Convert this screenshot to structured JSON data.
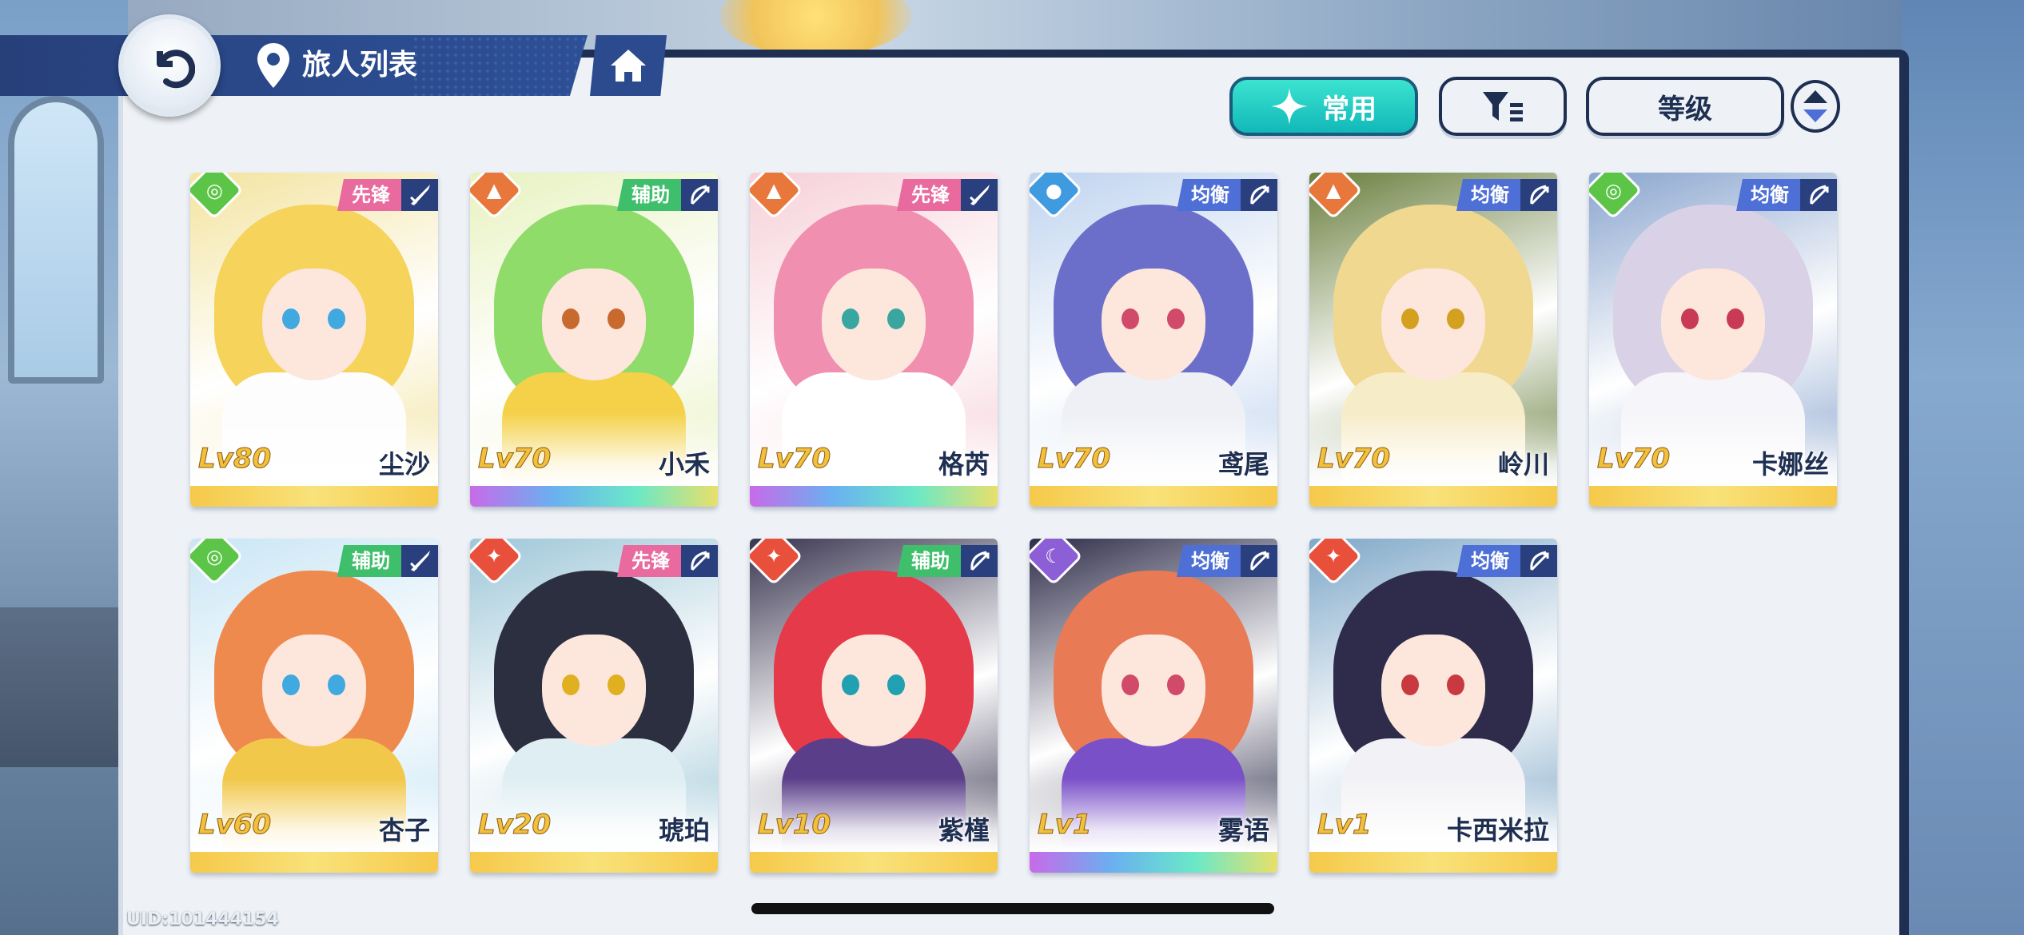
{
  "header": {
    "title": "旅人列表",
    "back_icon": "back-arrow-icon",
    "location_icon": "location-pin-icon",
    "home_icon": "home-icon"
  },
  "toolbar": {
    "common_label": "常用",
    "filter_icon": "filter-icon",
    "sort_label": "等级",
    "order_icon": "sort-order-icon"
  },
  "colors": {
    "accent_teal": "#19c4c0",
    "navy": "#1e2f52",
    "vanguard_pink": "#e86a9e",
    "support_green": "#3fbf6b",
    "balance_blue": "#4d6fd6"
  },
  "characters": [
    {
      "name": "尘沙",
      "level": "Lv80",
      "role": "先锋",
      "element": "wind",
      "weapon": "sword-icon",
      "rarity": "gold"
    },
    {
      "name": "小禾",
      "level": "Lv70",
      "role": "辅助",
      "element": "rock",
      "weapon": "bow-icon",
      "rarity": "rainbow"
    },
    {
      "name": "格芮",
      "level": "Lv70",
      "role": "先锋",
      "element": "rock",
      "weapon": "sword-icon",
      "rarity": "rainbow"
    },
    {
      "name": "鸢尾",
      "level": "Lv70",
      "role": "均衡",
      "element": "water",
      "weapon": "bow-icon",
      "rarity": "gold"
    },
    {
      "name": "岭川",
      "level": "Lv70",
      "role": "均衡",
      "element": "rock",
      "weapon": "bow-icon",
      "rarity": "gold"
    },
    {
      "name": "卡娜丝",
      "level": "Lv70",
      "role": "均衡",
      "element": "wind",
      "weapon": "bow-icon",
      "rarity": "gold"
    },
    {
      "name": "杏子",
      "level": "Lv60",
      "role": "辅助",
      "element": "wind",
      "weapon": "sword-icon",
      "rarity": "gold"
    },
    {
      "name": "琥珀",
      "level": "Lv20",
      "role": "先锋",
      "element": "fire",
      "weapon": "bow-icon",
      "rarity": "gold"
    },
    {
      "name": "紫槿",
      "level": "Lv10",
      "role": "辅助",
      "element": "fire",
      "weapon": "bow-icon",
      "rarity": "gold"
    },
    {
      "name": "雾语",
      "level": "Lv1",
      "role": "均衡",
      "element": "moon",
      "weapon": "bow-icon",
      "rarity": "rainbow"
    },
    {
      "name": "卡西米拉",
      "level": "Lv1",
      "role": "均衡",
      "element": "fire",
      "weapon": "bow-icon",
      "rarity": "gold"
    }
  ],
  "footer": {
    "uid": "UID:101444154"
  }
}
